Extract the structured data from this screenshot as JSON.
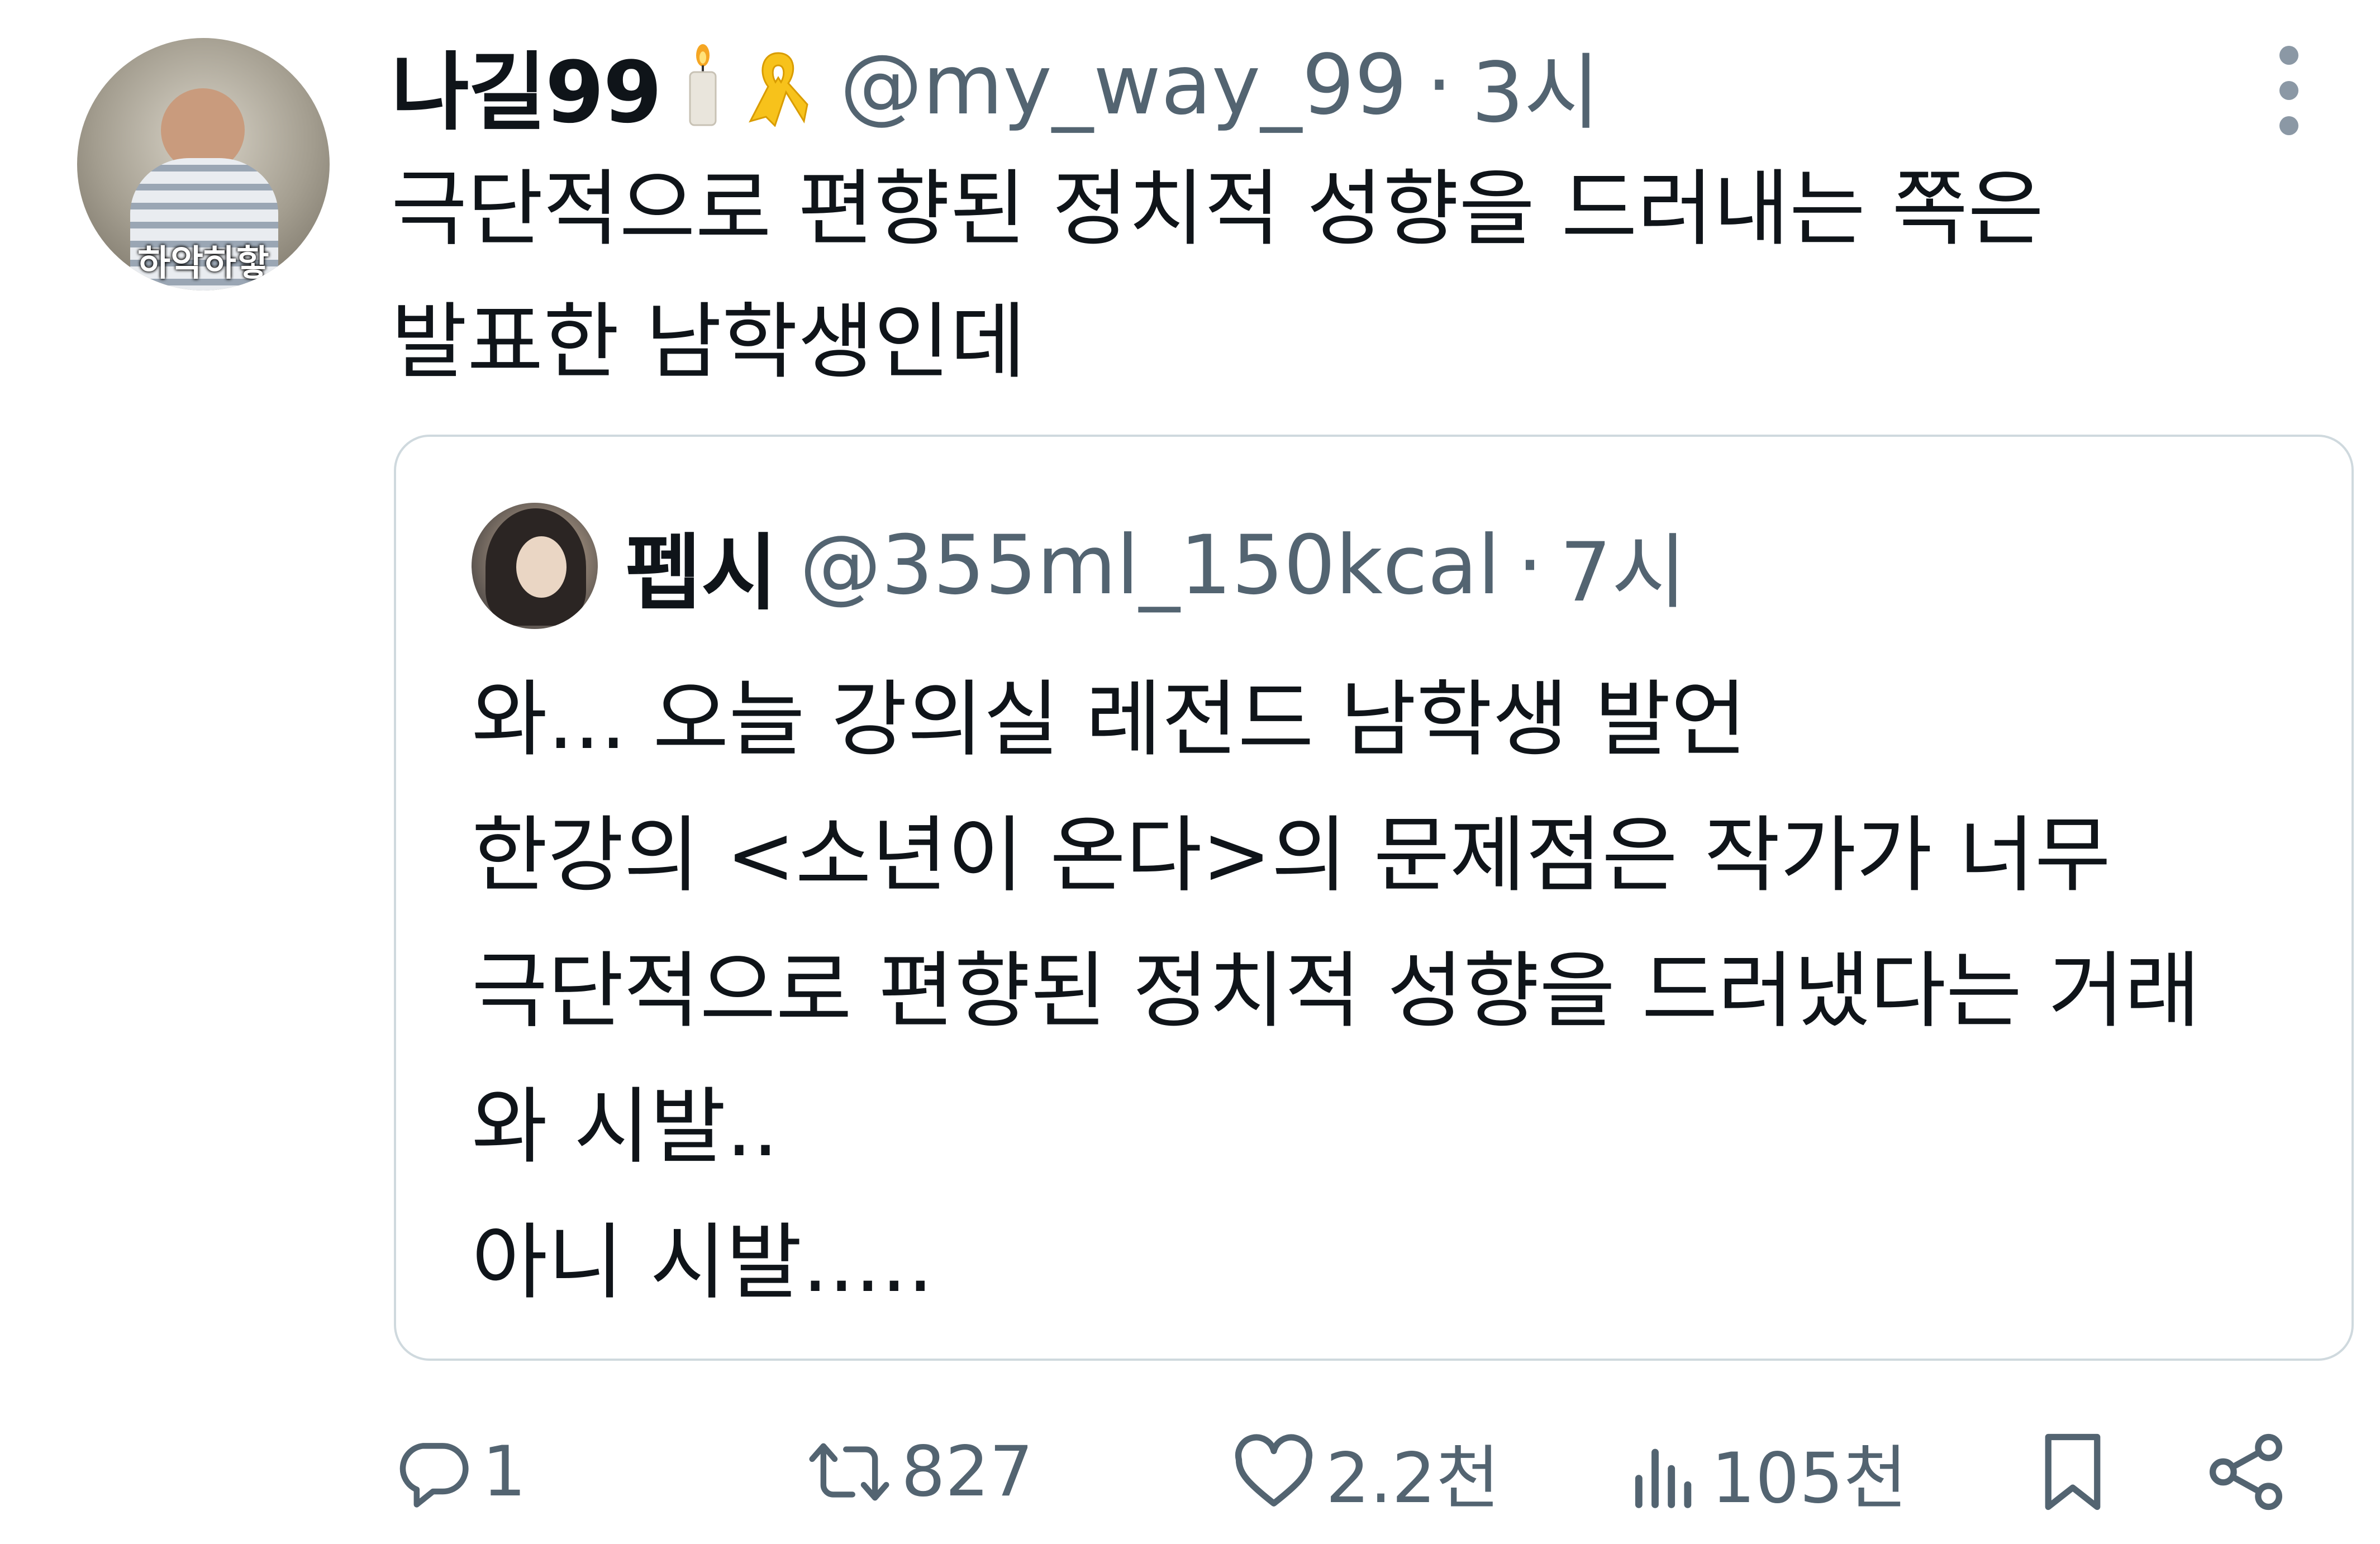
{
  "tweet": {
    "author": {
      "display_name": "나길99",
      "handle": "@my_way_99",
      "separator": "·",
      "time": "3시",
      "avatar_caption": "하악하핳"
    },
    "emoji": [
      "candle-icon",
      "yellow-ribbon-icon"
    ],
    "text": "극단적으로 편향된 정치적 성향을 드러내는 쪽은\n발표한 남학생인데",
    "quoted": {
      "display_name": "펩시",
      "handle": "@355ml_150kcal",
      "separator": "·",
      "time": "7시",
      "text": "와... 오늘 강의실 레전드 남학생 발언\n한강의 <소년이 온다>의 문제점은 작가가 너무\n극단적으로 편향된 정치적 성향을 드러냈다는 거래\n와 시발..\n아니 시발....."
    },
    "actions": {
      "reply_count": "1",
      "retweet_count": "827",
      "like_count": "2.2천",
      "views_count": "105천"
    }
  },
  "colors": {
    "secondary_text": "#536471",
    "primary_text": "#0f1419",
    "border": "#cfd9de"
  }
}
